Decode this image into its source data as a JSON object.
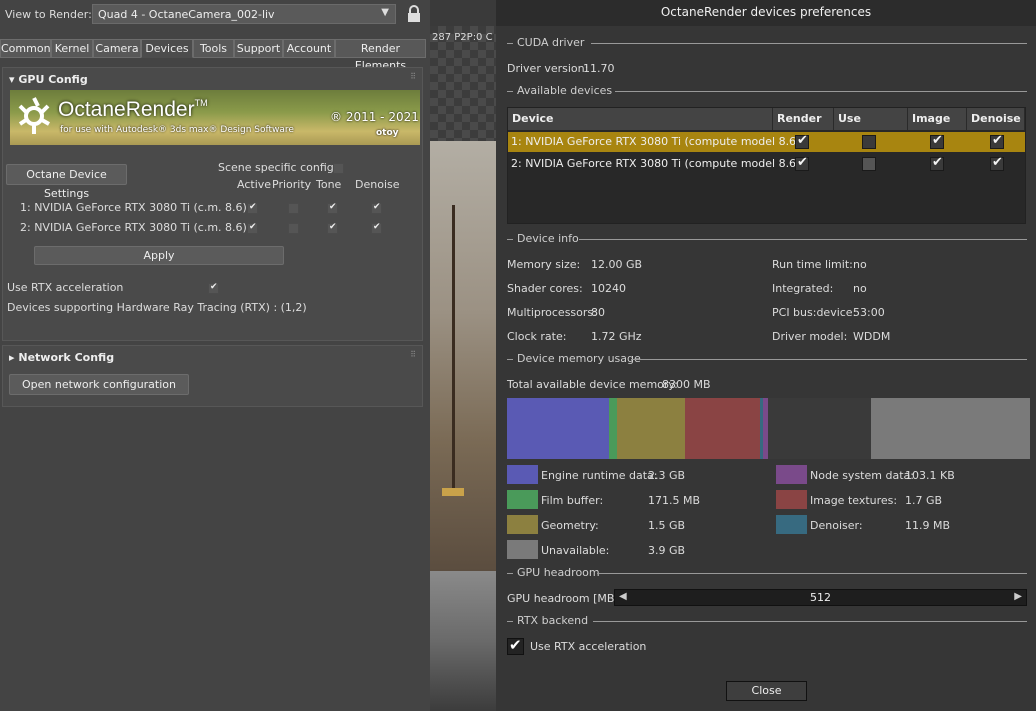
{
  "view_render": {
    "label": "View to Render:",
    "value": "Quad 4 - OctaneCamera_002-liv"
  },
  "tabs": [
    "Common",
    "Kernel",
    "Camera",
    "Devices",
    "Tools",
    "Support",
    "Account",
    "Render Elements"
  ],
  "viewport_text": "287 P2P:0  C",
  "gpu_config": {
    "title": "GPU Config",
    "banner": {
      "brand": "OctaneRender",
      "tm": "TM",
      "sub": "for use with Autodesk® 3ds max® Design Software",
      "years": "® 2011 - 2021",
      "otoy": "otoy"
    },
    "device_settings_btn": "Octane Device Settings",
    "scene_specific": "Scene specific config",
    "cols": [
      "Active",
      "Priority",
      "Tone",
      "Denoise"
    ],
    "devices": [
      "1:  NVIDIA GeForce RTX 3080 Ti (c.m. 8.6)",
      "2:  NVIDIA GeForce RTX 3080 Ti (c.m. 8.6)"
    ],
    "apply": "Apply",
    "use_rtx": "Use RTX acceleration",
    "rtx_support": "Devices supporting Hardware Ray Tracing (RTX) : (1,2)"
  },
  "network_config": {
    "title": "Network Config",
    "open_btn": "Open network configuration"
  },
  "dialog": {
    "title": "OctaneRender devices preferences",
    "cuda": {
      "section": "CUDA driver",
      "driver_version_label": "Driver version:",
      "driver_version": "11.70"
    },
    "available": {
      "section": "Available devices",
      "columns": [
        "Device",
        "Render",
        "Use priority",
        "Image",
        "Denoise"
      ],
      "rows": [
        {
          "name": "1: NVIDIA GeForce RTX 3080 Ti (compute model 8.6)",
          "render": true,
          "priority": false,
          "image": true,
          "denoise": true,
          "selected": true
        },
        {
          "name": "2: NVIDIA GeForce RTX 3080 Ti (compute model 8.6)",
          "render": true,
          "priority": false,
          "image": true,
          "denoise": true,
          "selected": false
        }
      ]
    },
    "info": {
      "section": "Device info",
      "left": [
        {
          "label": "Memory size:",
          "value": "12.00 GB"
        },
        {
          "label": "Shader cores:",
          "value": "10240"
        },
        {
          "label": "Multiprocessors:",
          "value": "80"
        },
        {
          "label": "Clock rate:",
          "value": "1.72 GHz"
        }
      ],
      "right": [
        {
          "label": "Run time limit:",
          "value": "no"
        },
        {
          "label": "Integrated:",
          "value": "no"
        },
        {
          "label": "PCI bus:device:",
          "value": "53:00"
        },
        {
          "label": "Driver model:",
          "value": "WDDM"
        }
      ]
    },
    "memory": {
      "section": "Device memory usage",
      "total_label": "Total available device memory:",
      "total_value": "8300 MB",
      "bar_segments": [
        {
          "name": "Engine runtime data",
          "fraction": 0.195,
          "color": "#5a5ab4"
        },
        {
          "name": "Film buffer",
          "fraction": 0.015,
          "color": "#4a9a5a"
        },
        {
          "name": "Geometry",
          "fraction": 0.13,
          "color": "#8c8040"
        },
        {
          "name": "Image textures",
          "fraction": 0.143,
          "color": "#8a4444"
        },
        {
          "name": "Denoiser",
          "fraction": 0.005,
          "color": "#376a80"
        },
        {
          "name": "Node system data",
          "fraction": 0.01,
          "color": "#7a4a8a"
        },
        {
          "name": "Other",
          "fraction": 0.197,
          "color": "#3a3a3a"
        },
        {
          "name": "Unavailable",
          "fraction": 0.305,
          "color": "#7a7a7a"
        }
      ],
      "legend_left": [
        {
          "label": "Engine runtime data:",
          "value": "2.3 GB",
          "color": "#5a5ab4"
        },
        {
          "label": "Film buffer:",
          "value": "171.5 MB",
          "color": "#4a9a5a"
        },
        {
          "label": "Geometry:",
          "value": "1.5 GB",
          "color": "#8c8040"
        },
        {
          "label": "Unavailable:",
          "value": "3.9 GB",
          "color": "#7a7a7a"
        }
      ],
      "legend_right": [
        {
          "label": "Node system data:",
          "value": "103.1 KB",
          "color": "#7a4a8a"
        },
        {
          "label": "Image textures:",
          "value": "1.7 GB",
          "color": "#8a4444"
        },
        {
          "label": "Denoiser:",
          "value": "11.9 MB",
          "color": "#376a80"
        }
      ]
    },
    "headroom": {
      "section": "GPU headroom",
      "label": "GPU headroom [MB]:",
      "value": "512"
    },
    "rtx": {
      "section": "RTX backend",
      "label": "Use RTX acceleration"
    },
    "close": "Close"
  }
}
